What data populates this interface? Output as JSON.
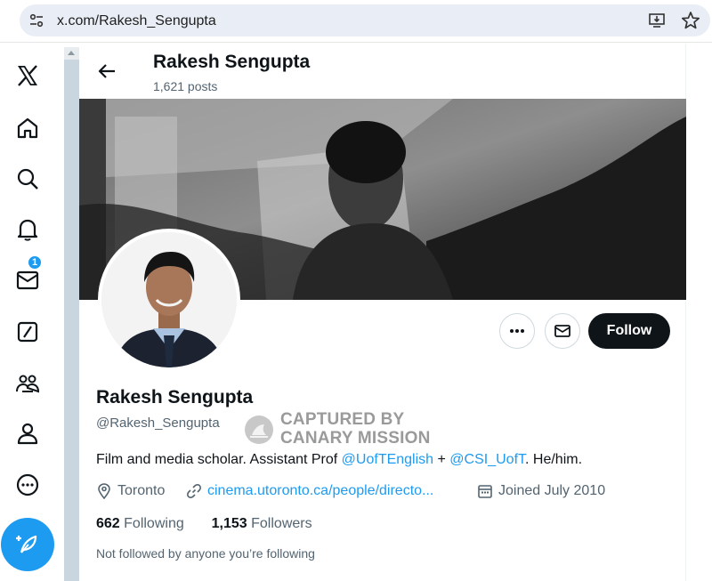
{
  "browser": {
    "url": "x.com/Rakesh_Sengupta"
  },
  "nav": {
    "items": [
      "x-logo",
      "home-icon",
      "search-icon",
      "bell-icon",
      "mail-icon",
      "grok-icon",
      "communities-icon",
      "profile-icon",
      "more-icon"
    ],
    "notification_count": "1"
  },
  "header": {
    "name": "Rakesh Sengupta",
    "posts": "1,621 posts"
  },
  "profile": {
    "follow_label": "Follow",
    "name": "Rakesh Sengupta",
    "handle": "@Rakesh_Sengupta",
    "bio_text": "Film and media scholar. Assistant Prof ",
    "bio_mention1": "@UofTEnglish",
    "bio_join": " + ",
    "bio_mention2": "@CSI_UofT",
    "bio_tail": ". He/him.",
    "location": "Toronto",
    "website": "cinema.utoronto.ca/people/directo...",
    "joined": "Joined July 2010",
    "following_count": "662",
    "following_label": " Following",
    "followers_count": "1,153",
    "followers_label": " Followers",
    "not_followed": "Not followed by anyone you’re following"
  },
  "watermark": {
    "line1": "CAPTURED BY",
    "line2": "CANARY MISSION"
  },
  "colors": {
    "accent": "#1d9bf0",
    "text": "#0f1419",
    "muted": "#536471"
  }
}
